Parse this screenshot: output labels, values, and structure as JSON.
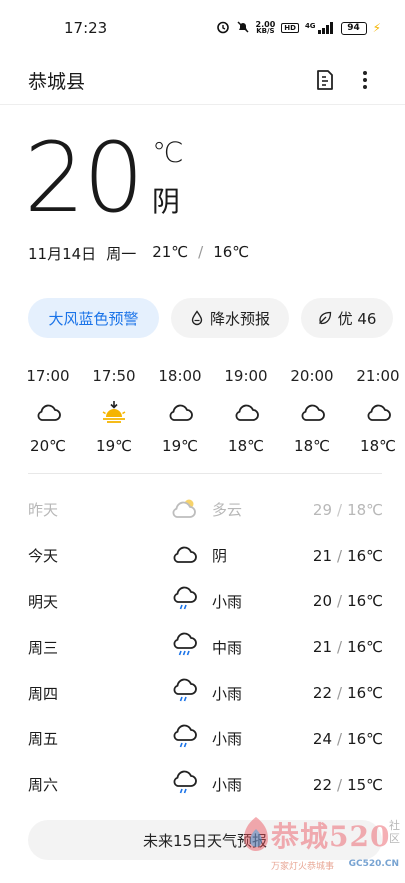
{
  "status_bar": {
    "time": "17:23",
    "net_speed_value": "2.00",
    "net_speed_unit": "KB/S",
    "hd_badge": "HD",
    "signal_label": "4G",
    "battery": "94"
  },
  "header": {
    "city": "恭城县"
  },
  "current": {
    "temperature": "20",
    "unit": "℃",
    "condition": "阴",
    "date": "11月14日",
    "weekday": "周一",
    "high": "21℃",
    "low": "16℃",
    "sep": "/"
  },
  "chips": {
    "alert": "大风蓝色预警",
    "rain": "降水预报",
    "aqi": "优 46"
  },
  "hourly": [
    {
      "time": "17:00",
      "icon": "cloud-icon",
      "temp": "20℃"
    },
    {
      "time": "17:50",
      "icon": "sunset-icon",
      "temp": "19℃"
    },
    {
      "time": "18:00",
      "icon": "cloud-icon",
      "temp": "19℃"
    },
    {
      "time": "19:00",
      "icon": "cloud-icon",
      "temp": "18℃"
    },
    {
      "time": "20:00",
      "icon": "cloud-icon",
      "temp": "18℃"
    },
    {
      "time": "21:00",
      "icon": "cloud-icon",
      "temp": "18℃"
    }
  ],
  "daily": [
    {
      "day": "昨天",
      "icon": "partly-cloudy-icon",
      "cond": "多云",
      "high": "29",
      "low": "18℃"
    },
    {
      "day": "今天",
      "icon": "cloud-icon",
      "cond": "阴",
      "high": "21",
      "low": "16℃"
    },
    {
      "day": "明天",
      "icon": "light-rain-icon",
      "cond": "小雨",
      "high": "20",
      "low": "16℃"
    },
    {
      "day": "周三",
      "icon": "rain-icon",
      "cond": "中雨",
      "high": "21",
      "low": "16℃"
    },
    {
      "day": "周四",
      "icon": "light-rain-icon",
      "cond": "小雨",
      "high": "22",
      "low": "16℃"
    },
    {
      "day": "周五",
      "icon": "light-rain-icon",
      "cond": "小雨",
      "high": "24",
      "low": "16℃"
    },
    {
      "day": "周六",
      "icon": "light-rain-icon",
      "cond": "小雨",
      "high": "22",
      "low": "15℃"
    }
  ],
  "footer": {
    "forecast_button": "未来15日天气预报"
  },
  "watermark": {
    "site": "恭城520",
    "domain": "GC520.CN",
    "tagline": "万家灯火恭城事",
    "community": "社区"
  },
  "colors": {
    "accent": "#1a73e8",
    "chip_alert_bg": "#e5f0fd",
    "chip_bg": "#f3f3f3",
    "muted": "#b8b8b8",
    "sun": "#f5b400"
  }
}
